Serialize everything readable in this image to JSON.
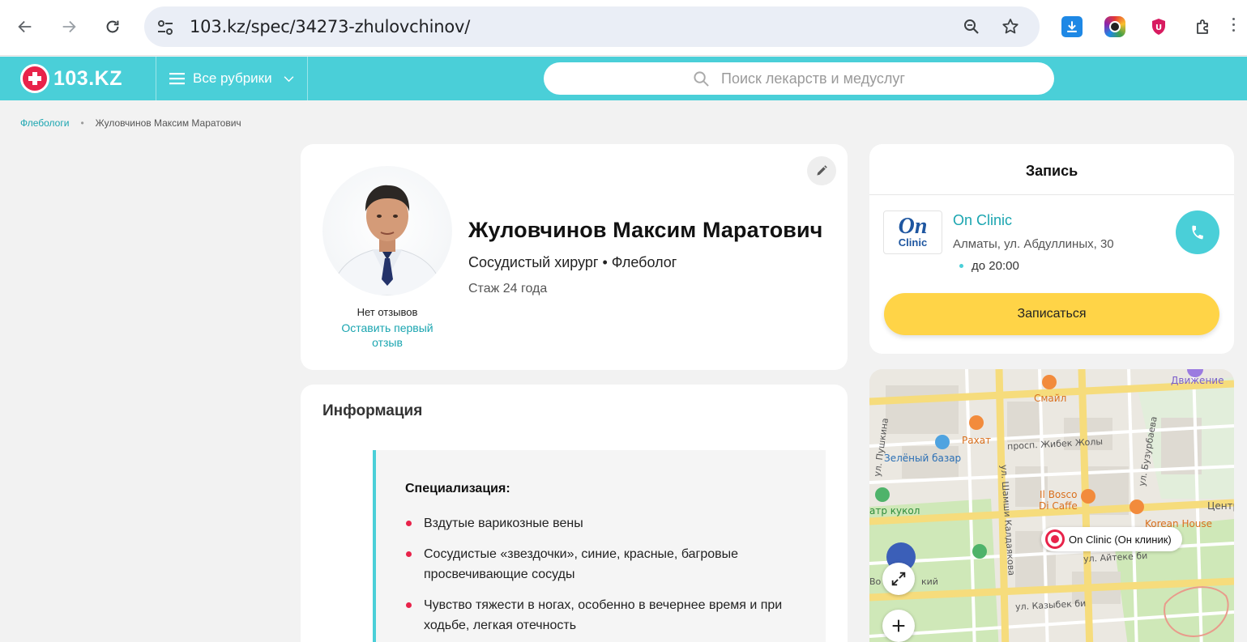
{
  "browser": {
    "url": "103.kz/spec/34273-zhulovchinov/"
  },
  "site": {
    "logo_text": "103.KZ",
    "rubrics_label": "Все рубрики",
    "search_placeholder": "Поиск лекарств и медуслуг"
  },
  "breadcrumb": {
    "parent": "Флебологи",
    "separator": "•",
    "current": "Жуловчинов Максим Маратович"
  },
  "profile": {
    "name": "Жуловчинов Максим Маратович",
    "specialty": "Сосудистый хирург • Флеболог",
    "experience": "Стаж 24 года",
    "no_reviews": "Нет отзывов",
    "leave_review": "Оставить первый отзыв"
  },
  "info": {
    "title": "Информация",
    "spec_heading": "Специализация:",
    "items": [
      "Вздутые варикозные вены",
      "Сосудистые «звездочки», синие, красные, багровые просвечивающие сосуды",
      "Чувство тяжести в ногах, особенно в вечернее время и при ходьбе, легкая отечность"
    ]
  },
  "booking": {
    "title": "Запись",
    "clinic_logo_top": "On",
    "clinic_logo_bottom": "Clinic",
    "clinic_name": "On Clinic",
    "clinic_address": "Алматы, ул. Абдуллиных, 30",
    "clinic_hours": "до 20:00",
    "book_button": "Записаться"
  },
  "map": {
    "pin_label": "On Clinic (Он клиник)",
    "labels": {
      "dvizhenie": "Движение",
      "smile": "Смайл",
      "rakhat": "Рахат",
      "zeleny": "Зелёный базар",
      "zhibek": "просп. Жибек Жолы",
      "pushkina": "ул. Пушкина",
      "bosco1": "Il Bosco",
      "bosco2": "Di Caffe",
      "kuklol": "атр кукол",
      "shamshi": "ул. Шамши Калдаякова",
      "korean": "Korean House",
      "buzurbaeva": "ул. Бузурбаева",
      "centr": "Центр",
      "aiteke": "ул. Айтеке би",
      "kazybek": "ул. Казыбек би",
      "kiy": "кий",
      "vo": "Во"
    }
  },
  "colors": {
    "accent": "#4acfd8",
    "brand_red": "#e8234a",
    "book_yellow": "#ffd447",
    "link": "#1aa5b0"
  }
}
